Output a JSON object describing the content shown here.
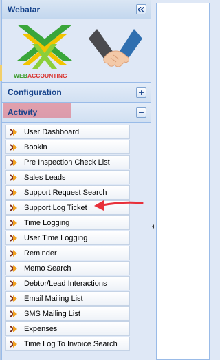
{
  "panel": {
    "title": "Webatar",
    "collapse_icon": "double-chevron-left-icon"
  },
  "logo": {
    "brand_text": "WEBACCOUNTING",
    "colors": {
      "green": "#3aa63a",
      "yellow": "#f2c400",
      "red": "#d9302a"
    },
    "side_image": "handshake-icon"
  },
  "sections": {
    "configuration": {
      "label": "Configuration",
      "toggle": "+"
    },
    "activity": {
      "label": "Activity",
      "toggle": "−"
    }
  },
  "menu": {
    "items": [
      {
        "label": "User Dashboard"
      },
      {
        "label": "Bookin"
      },
      {
        "label": "Pre Inspection Check List"
      },
      {
        "label": "Sales Leads"
      },
      {
        "label": "Support Request Search"
      },
      {
        "label": "Support Log Ticket"
      },
      {
        "label": "Time Logging"
      },
      {
        "label": "User Time Logging"
      },
      {
        "label": "Reminder"
      },
      {
        "label": "Memo Search"
      },
      {
        "label": "Debtor/Lead Interactions"
      },
      {
        "label": "Email Mailing List"
      },
      {
        "label": "SMS Mailing List"
      },
      {
        "label": "Expenses"
      },
      {
        "label": "Time Log To Invoice Search"
      }
    ]
  },
  "annotation": {
    "color": "#e8303a",
    "points_to": "Support Log Ticket"
  },
  "colors": {
    "header_text": "#15428b",
    "panel_bg": "#dfe8f6",
    "border": "#99bbe8",
    "highlight": "#e06070"
  }
}
